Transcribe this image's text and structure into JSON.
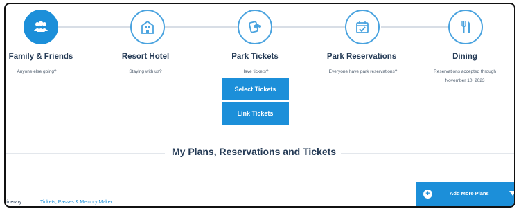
{
  "steps": [
    {
      "title": "Family & Friends",
      "subtitle": "Anyone else going?",
      "icon": "family-icon",
      "active": true
    },
    {
      "title": "Resort Hotel",
      "subtitle": "Staying with us?",
      "icon": "hotel-icon",
      "active": false
    },
    {
      "title": "Park Tickets",
      "subtitle": "Have tickets?",
      "icon": "ticket-icon",
      "active": false
    },
    {
      "title": "Park Reservations",
      "subtitle": "Everyone have park reservations?",
      "icon": "calendar-check-icon",
      "active": false
    },
    {
      "title": "Dining",
      "subtitle_line1": "Reservations accepted through",
      "subtitle_line2": "November 10, 2023",
      "icon": "fork-knife-icon",
      "active": false
    }
  ],
  "buttons": {
    "select_tickets": "Select Tickets",
    "link_tickets": "Link Tickets"
  },
  "section": {
    "title": "My Plans, Reservations and Tickets"
  },
  "tabs": [
    {
      "label": "tinerary"
    },
    {
      "label": "Tickets, Passes & Memory Maker"
    }
  ],
  "add_plans": {
    "label": "Add More Plans"
  },
  "colors": {
    "accent": "#1c8fd9",
    "text": "#253b56",
    "link": "#1c8fd9"
  }
}
